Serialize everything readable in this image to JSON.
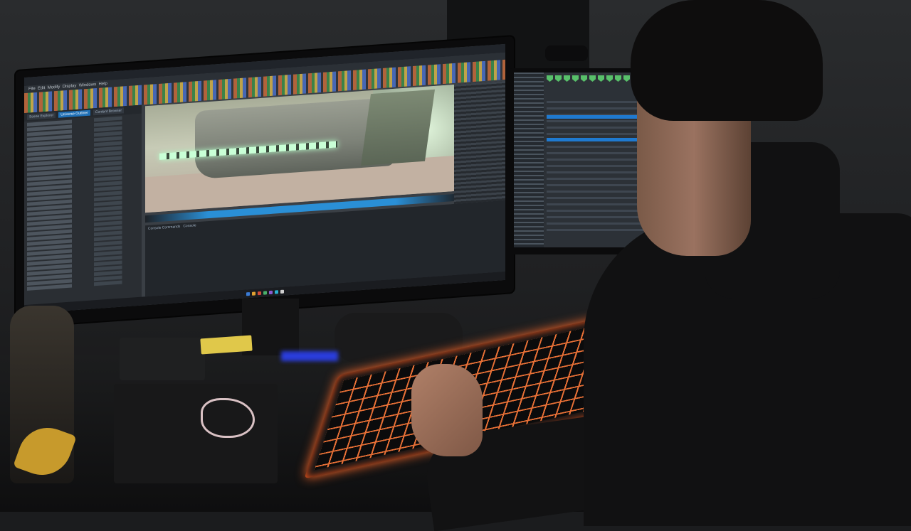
{
  "scene": {
    "description_tag": "developer-desk-dual-monitor",
    "main_monitor": {
      "titlebar_text": "",
      "menu_items": [
        "File",
        "Edit",
        "Modify",
        "Display",
        "Windows",
        "Help"
      ],
      "panel_tabs": [
        "Scene Explorer",
        "Universe Outliner",
        "Content Browser"
      ],
      "console_tabs": [
        "Console Commands",
        "Console"
      ]
    },
    "colors": {
      "accent_blue": "#1f6fb5",
      "keyboard_glow": "#ff6a2a",
      "viewport_light": "#c9ffd6",
      "shield_green": "#58c06a"
    }
  }
}
